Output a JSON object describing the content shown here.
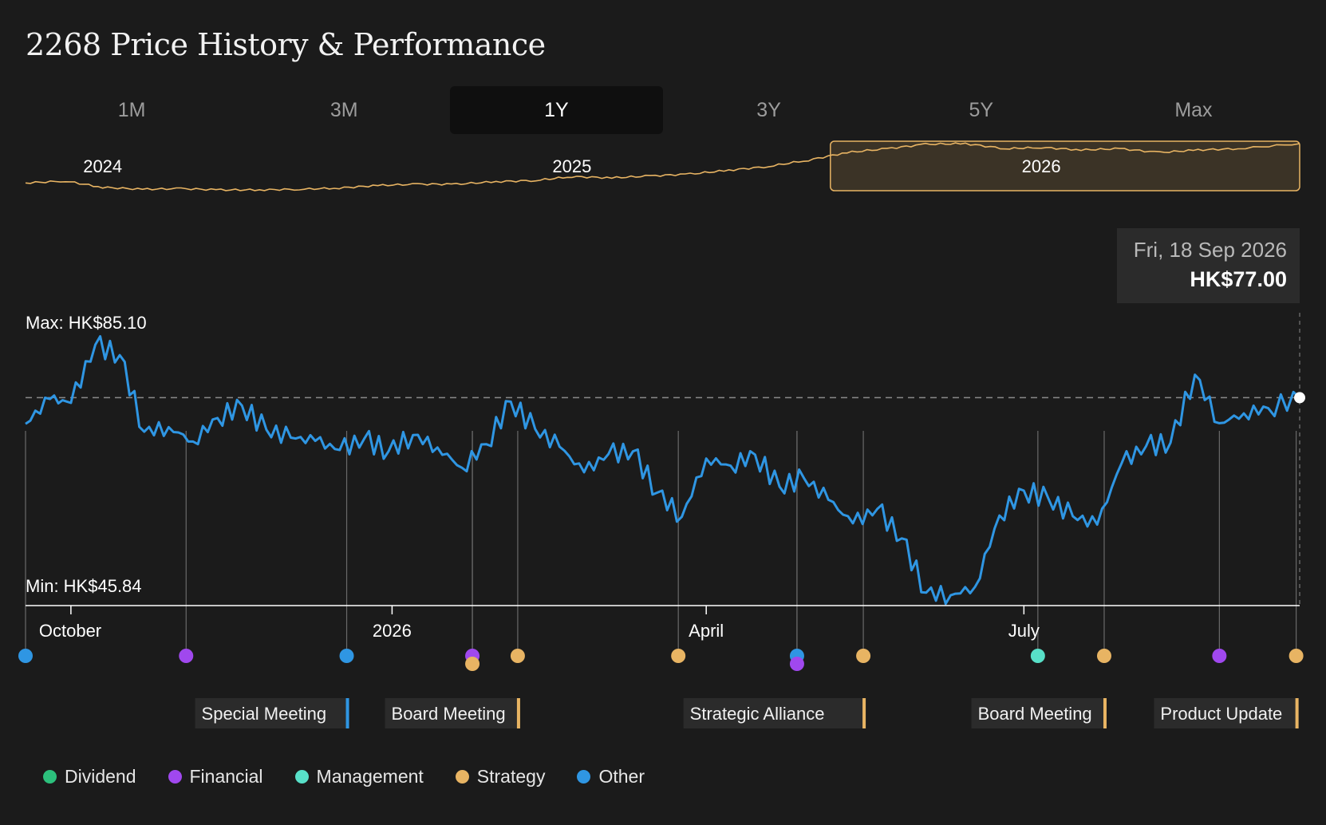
{
  "title": "2268 Price History & Performance",
  "tabs": [
    {
      "label": "1M",
      "active": false
    },
    {
      "label": "3M",
      "active": false
    },
    {
      "label": "1Y",
      "active": true
    },
    {
      "label": "3Y",
      "active": false
    },
    {
      "label": "5Y",
      "active": false
    },
    {
      "label": "Max",
      "active": false
    }
  ],
  "tooltip": {
    "date": "Fri, 18 Sep 2026",
    "price": "HK$77.00"
  },
  "colors": {
    "background": "#1b1b1b",
    "price_line": "#2f96e3",
    "overview_line": "#e8b463",
    "Dividend": "#2cc07c",
    "Financial": "#a048ee",
    "Management": "#58e0c8",
    "Strategy": "#e8b463",
    "Other": "#2f96e3"
  },
  "legend": [
    {
      "label": "Dividend",
      "category": "Dividend"
    },
    {
      "label": "Financial",
      "category": "Financial"
    },
    {
      "label": "Management",
      "category": "Management"
    },
    {
      "label": "Strategy",
      "category": "Strategy"
    },
    {
      "label": "Other",
      "category": "Other"
    }
  ],
  "chart_data": [
    {
      "type": "line",
      "role": "overview",
      "year_labels": [
        "2024",
        "2025",
        "2026"
      ],
      "x": [
        "2024-01-01",
        "2024-02-01",
        "2024-03-01",
        "2024-04-01",
        "2024-05-01",
        "2024-06-01",
        "2024-07-01",
        "2024-08-01",
        "2024-09-01",
        "2024-10-01",
        "2024-11-01",
        "2024-12-01",
        "2025-01-01",
        "2025-02-01",
        "2025-03-01",
        "2025-04-01",
        "2025-05-01",
        "2025-06-01",
        "2025-07-01",
        "2025-08-01",
        "2025-09-01",
        "2025-10-01",
        "2025-11-01",
        "2025-12-01",
        "2026-01-01",
        "2026-02-01",
        "2026-03-01",
        "2026-04-01",
        "2026-05-01",
        "2026-06-01",
        "2026-07-01",
        "2026-08-01",
        "2026-09-18"
      ],
      "values": [
        66,
        69,
        59,
        56,
        57,
        55,
        55,
        56,
        58,
        62,
        64,
        64,
        68,
        70,
        76,
        74,
        77,
        80,
        86,
        92,
        102,
        114,
        120,
        127,
        128,
        120,
        122,
        118,
        120,
        114,
        118,
        120,
        128
      ],
      "selected_range": [
        "2025-09-18",
        "2026-09-18"
      ]
    },
    {
      "type": "line",
      "role": "main",
      "x_tick_labels": [
        "October",
        "2026",
        "April",
        "July"
      ],
      "x": [
        "2025-09-18",
        "2025-09-25",
        "2025-10-01",
        "2025-10-08",
        "2025-10-15",
        "2025-10-22",
        "2025-10-29",
        "2025-11-05",
        "2025-11-12",
        "2025-11-19",
        "2025-11-26",
        "2025-12-03",
        "2025-12-10",
        "2025-12-17",
        "2025-12-24",
        "2025-12-31",
        "2026-01-07",
        "2026-01-14",
        "2026-01-21",
        "2026-01-28",
        "2026-02-04",
        "2026-02-11",
        "2026-02-18",
        "2026-02-25",
        "2026-03-04",
        "2026-03-11",
        "2026-03-18",
        "2026-03-25",
        "2026-04-01",
        "2026-04-08",
        "2026-04-15",
        "2026-04-22",
        "2026-04-29",
        "2026-05-06",
        "2026-05-13",
        "2026-05-20",
        "2026-05-27",
        "2026-06-03",
        "2026-06-10",
        "2026-06-17",
        "2026-06-24",
        "2026-07-01",
        "2026-07-08",
        "2026-07-15",
        "2026-07-22",
        "2026-07-29",
        "2026-08-05",
        "2026-08-12",
        "2026-08-19",
        "2026-08-26",
        "2026-09-02",
        "2026-09-09",
        "2026-09-18"
      ],
      "values": [
        73.0,
        76.8,
        76.2,
        85.1,
        83.5,
        71.8,
        72.5,
        70.3,
        73.9,
        75.8,
        72.1,
        70.9,
        70.4,
        69.0,
        70.7,
        68.8,
        71.3,
        69.4,
        66.3,
        69.9,
        76.4,
        72.2,
        69.5,
        65.6,
        68.4,
        68.8,
        62.5,
        58.8,
        67.7,
        66.6,
        68.3,
        63.4,
        64.7,
        61.4,
        57.8,
        60.0,
        55.5,
        47.2,
        46.8,
        48.1,
        59.0,
        62.8,
        61.6,
        58.9,
        57.6,
        67.0,
        69.6,
        70.1,
        80.5,
        73.1,
        74.6,
        75.4,
        77.0
      ],
      "max_label": "Max: HK$85.10",
      "min_label": "Min: HK$45.84",
      "max": 85.1,
      "min": 45.84,
      "reference_value": 77.0,
      "events": [
        {
          "date": "2025-09-18",
          "category": "Other"
        },
        {
          "date": "2025-11-03",
          "category": "Financial"
        },
        {
          "date": "2025-12-19",
          "category": "Other",
          "label": "Special Meeting"
        },
        {
          "date": "2026-01-24",
          "category": "Financial"
        },
        {
          "date": "2026-01-24",
          "category": "Strategy"
        },
        {
          "date": "2026-02-06",
          "category": "Strategy",
          "label": "Board Meeting"
        },
        {
          "date": "2026-03-24",
          "category": "Strategy"
        },
        {
          "date": "2026-04-27",
          "category": "Other"
        },
        {
          "date": "2026-04-27",
          "category": "Financial"
        },
        {
          "date": "2026-05-16",
          "category": "Strategy",
          "label": "Strategic Alliance"
        },
        {
          "date": "2026-07-05",
          "category": "Management"
        },
        {
          "date": "2026-07-24",
          "category": "Strategy",
          "label": "Board Meeting"
        },
        {
          "date": "2026-08-26",
          "category": "Financial"
        },
        {
          "date": "2026-09-17",
          "category": "Strategy",
          "label": "Product Update"
        }
      ]
    }
  ]
}
